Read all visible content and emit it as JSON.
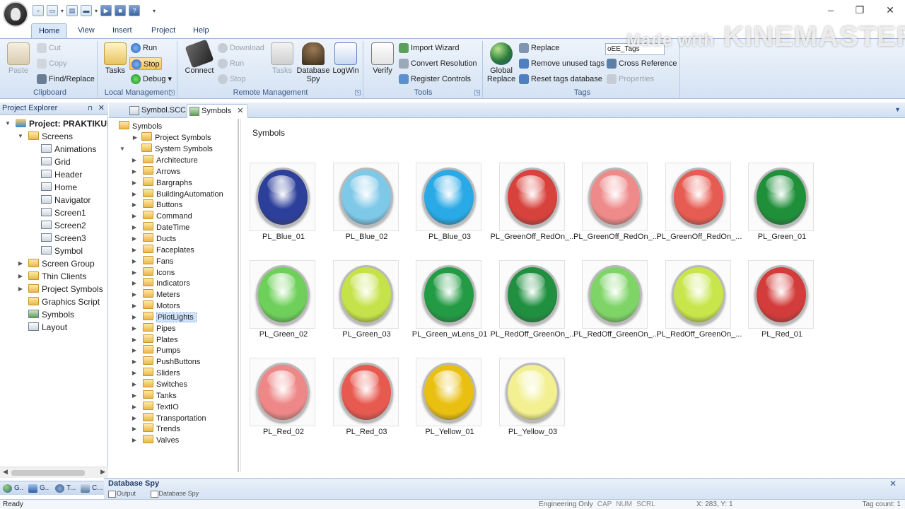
{
  "ribbon_tabs": [
    "Home",
    "View",
    "Insert",
    "Project",
    "Help"
  ],
  "watermark": {
    "prefix": "Made with",
    "brand": "KINEMASTER"
  },
  "clipboard": {
    "paste": "Paste",
    "cut": "Cut",
    "copy": "Copy",
    "find_replace": "Find/Replace",
    "label": "Clipboard"
  },
  "local_management": {
    "tasks": "Tasks",
    "run": "Run",
    "stop": "Stop",
    "debug": "Debug",
    "label": "Local Management"
  },
  "remote_management": {
    "connect": "Connect",
    "download": "Download",
    "run": "Run",
    "stop": "Stop",
    "tasks": "Tasks",
    "database_spy_1": "Database",
    "database_spy_2": "Spy",
    "logwin": "LogWin",
    "label": "Remote Management"
  },
  "tools": {
    "verify": "Verify",
    "import_wizard": "Import Wizard",
    "convert_resolution": "Convert Resolution",
    "register_controls": "Register Controls",
    "label": "Tools"
  },
  "tags": {
    "global_replace_1": "Global",
    "global_replace_2": "Replace",
    "replace": "Replace",
    "remove_unused": "Remove unused tags",
    "reset_db": "Reset tags database",
    "tags_dropdown": "oEE_Tags",
    "cross_reference": "Cross Reference",
    "properties": "Properties",
    "label": "Tags"
  },
  "explorer": {
    "title": "Project Explorer",
    "root": "Project: PRAKTIKUM",
    "screens_label": "Screens",
    "screens": [
      "Animations",
      "Grid",
      "Header",
      "Home",
      "Navigator",
      "Screen1",
      "Screen2",
      "Screen3",
      "Symbol"
    ],
    "others": [
      "Screen Group",
      "Thin Clients",
      "Project Symbols",
      "Graphics Script",
      "Symbols",
      "Layout"
    ]
  },
  "bottom_tabs": [
    "G..",
    "G..",
    "T...",
    "C..."
  ],
  "doc_tabs": [
    "Symbol.SCC",
    "Symbols"
  ],
  "symtree": {
    "root": "Symbols",
    "project_symbols": "Project Symbols",
    "system_symbols": "System Symbols",
    "folders": [
      "Architecture",
      "Arrows",
      "Bargraphs",
      "BuildingAutomation",
      "Buttons",
      "Command",
      "DateTime",
      "Ducts",
      "Faceplates",
      "Fans",
      "Icons",
      "Indicators",
      "Meters",
      "Motors",
      "PilotLights",
      "Pipes",
      "Plates",
      "Pumps",
      "PushButtons",
      "Sliders",
      "Switches",
      "Tanks",
      "TextIO",
      "Transportation",
      "Trends",
      "Valves"
    ],
    "selected": "PilotLights"
  },
  "gallery": {
    "title": "Symbols",
    "items": [
      {
        "label": "PL_Blue_01",
        "color": "#2c3f9a"
      },
      {
        "label": "PL_Blue_02",
        "color": "#7ec8e8"
      },
      {
        "label": "PL_Blue_03",
        "color": "#29a9e6"
      },
      {
        "label": "PL_GreenOff_RedOn_...",
        "color": "#d8423d"
      },
      {
        "label": "PL_GreenOff_RedOn_...",
        "color": "#ee8a8a"
      },
      {
        "label": "PL_GreenOff_RedOn_...",
        "color": "#e65c52"
      },
      {
        "label": "PL_Green_01",
        "color": "#1f8f3a"
      },
      {
        "label": "PL_Green_02",
        "color": "#6ed05a"
      },
      {
        "label": "PL_Green_03",
        "color": "#c6e24a"
      },
      {
        "label": "PL_Green_wLens_01",
        "color": "#239a44"
      },
      {
        "label": "PL_RedOff_GreenOn_...",
        "color": "#209040"
      },
      {
        "label": "PL_RedOff_GreenOn_...",
        "color": "#7fd468"
      },
      {
        "label": "PL_RedOff_GreenOn_...",
        "color": "#c8e64c"
      },
      {
        "label": "PL_Red_01",
        "color": "#d23c3a"
      },
      {
        "label": "PL_Red_02",
        "color": "#ee8888"
      },
      {
        "label": "PL_Red_03",
        "color": "#e75a50"
      },
      {
        "label": "PL_Yellow_01",
        "color": "#e9c012"
      },
      {
        "label": "PL_Yellow_03",
        "color": "#f2f090"
      }
    ]
  },
  "database_spy": {
    "title": "Database Spy",
    "tabs": [
      "Output",
      "Database Spy"
    ]
  },
  "status": {
    "ready": "Ready",
    "mode": "Engineering Only",
    "caps": "CAP",
    "num": "NUM",
    "scrl": "SCRL",
    "coords": "X: 283, Y: 1",
    "tags": "Tag count: 1"
  }
}
